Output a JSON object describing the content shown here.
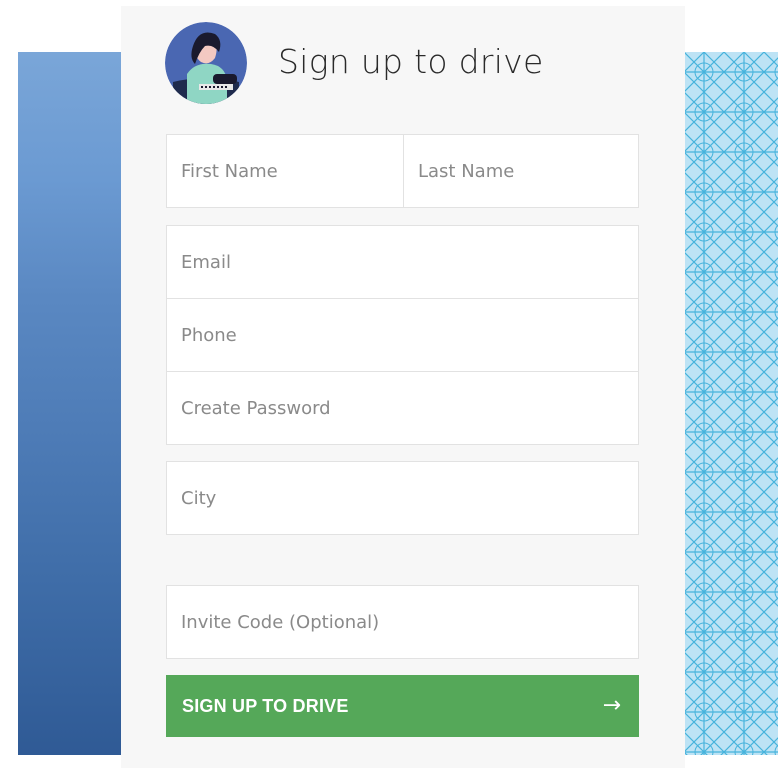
{
  "form": {
    "title": "Sign up to drive",
    "fields": {
      "first_name": "First Name",
      "last_name": "Last Name",
      "email": "Email",
      "phone": "Phone",
      "password": "Create Password",
      "city": "City",
      "invite_code": "Invite Code (Optional)"
    },
    "submit_label": "SIGN UP TO DRIVE",
    "submit_icon": "→"
  },
  "colors": {
    "accent": "#55a859",
    "card_background": "#f7f7f7",
    "left_panel": "#5a88c2",
    "right_pattern": "#4fb8e0"
  }
}
